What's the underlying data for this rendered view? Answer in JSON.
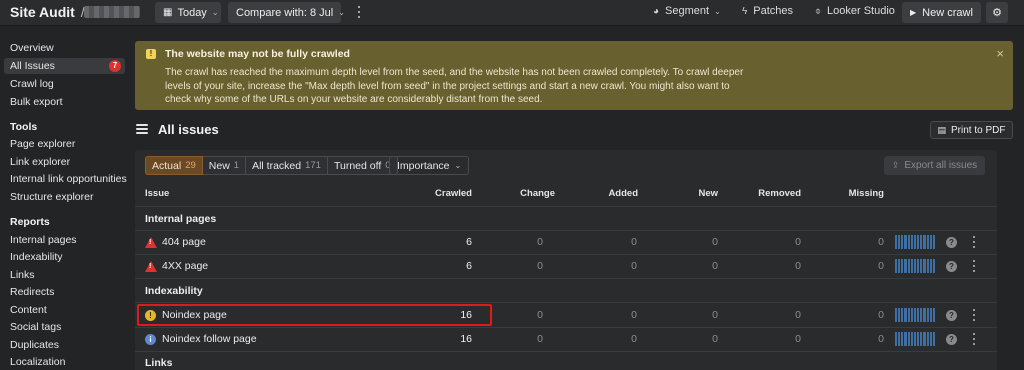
{
  "topbar": {
    "title": "Site Audit",
    "slash": "/",
    "date_button": "Today",
    "compare_button": "Compare with: 8 Jul",
    "segment": "Segment",
    "patches": "Patches",
    "looker": "Looker Studio",
    "new_crawl": "New crawl"
  },
  "sidebar": {
    "items": [
      {
        "label": "Overview"
      },
      {
        "label": "All Issues",
        "badge": "7"
      },
      {
        "label": "Crawl log"
      },
      {
        "label": "Bulk export"
      }
    ],
    "tools_heading": "Tools",
    "tools": [
      "Page explorer",
      "Link explorer",
      "Internal link opportunities",
      "Structure explorer"
    ],
    "reports_heading": "Reports",
    "reports": [
      "Internal pages",
      "Indexability",
      "Links",
      "Redirects",
      "Content",
      "Social tags",
      "Duplicates",
      "Localization"
    ]
  },
  "banner": {
    "icon": "!",
    "title": "The website may not be fully crawled",
    "text": "The crawl has reached the maximum depth level from the seed, and the website has not been crawled completely. To crawl deeper levels of your site, increase the \"Max depth level from seed\" in the project settings and start a new crawl. You might also want to check why some of the URLs on your website are considerably distant from the seed.",
    "close": "×"
  },
  "page": {
    "title": "All issues",
    "print_button": "Print to PDF"
  },
  "filters": {
    "tabs": [
      {
        "label": "Actual",
        "count": "29"
      },
      {
        "label": "New",
        "count": "1"
      },
      {
        "label": "All tracked",
        "count": "171"
      },
      {
        "label": "Turned off",
        "count": "0"
      }
    ],
    "importance": "Importance",
    "export": "Export all issues"
  },
  "table": {
    "headers": {
      "issue": "Issue",
      "crawled": "Crawled",
      "change": "Change",
      "added": "Added",
      "new": "New",
      "removed": "Removed",
      "missing": "Missing"
    },
    "groups": [
      {
        "label": "Internal pages",
        "rows": [
          {
            "name": "404 page",
            "crawled": "6",
            "change": "0",
            "added": "0",
            "new": "0",
            "removed": "0",
            "missing": "0",
            "icon": "error-triangle"
          },
          {
            "name": "4XX page",
            "crawled": "6",
            "change": "0",
            "added": "0",
            "new": "0",
            "removed": "0",
            "missing": "0",
            "icon": "error-triangle"
          }
        ]
      },
      {
        "label": "Indexability",
        "rows": [
          {
            "name": "Noindex page",
            "crawled": "16",
            "change": "0",
            "added": "0",
            "new": "0",
            "removed": "0",
            "missing": "0",
            "icon": "warning-circle"
          },
          {
            "name": "Noindex follow page",
            "crawled": "16",
            "change": "0",
            "added": "0",
            "new": "0",
            "removed": "0",
            "missing": "0",
            "icon": "info-circle"
          }
        ]
      },
      {
        "label": "Links",
        "rows": []
      }
    ],
    "help_glyph": "?"
  },
  "colors": {
    "accent_orange": "#e4a35e",
    "error_red": "#e0302f",
    "warning_yellow": "#e9b52d",
    "info_blue": "#5b8ad0",
    "banner_bg": "#69602f",
    "highlight_red": "#e01a1a"
  }
}
